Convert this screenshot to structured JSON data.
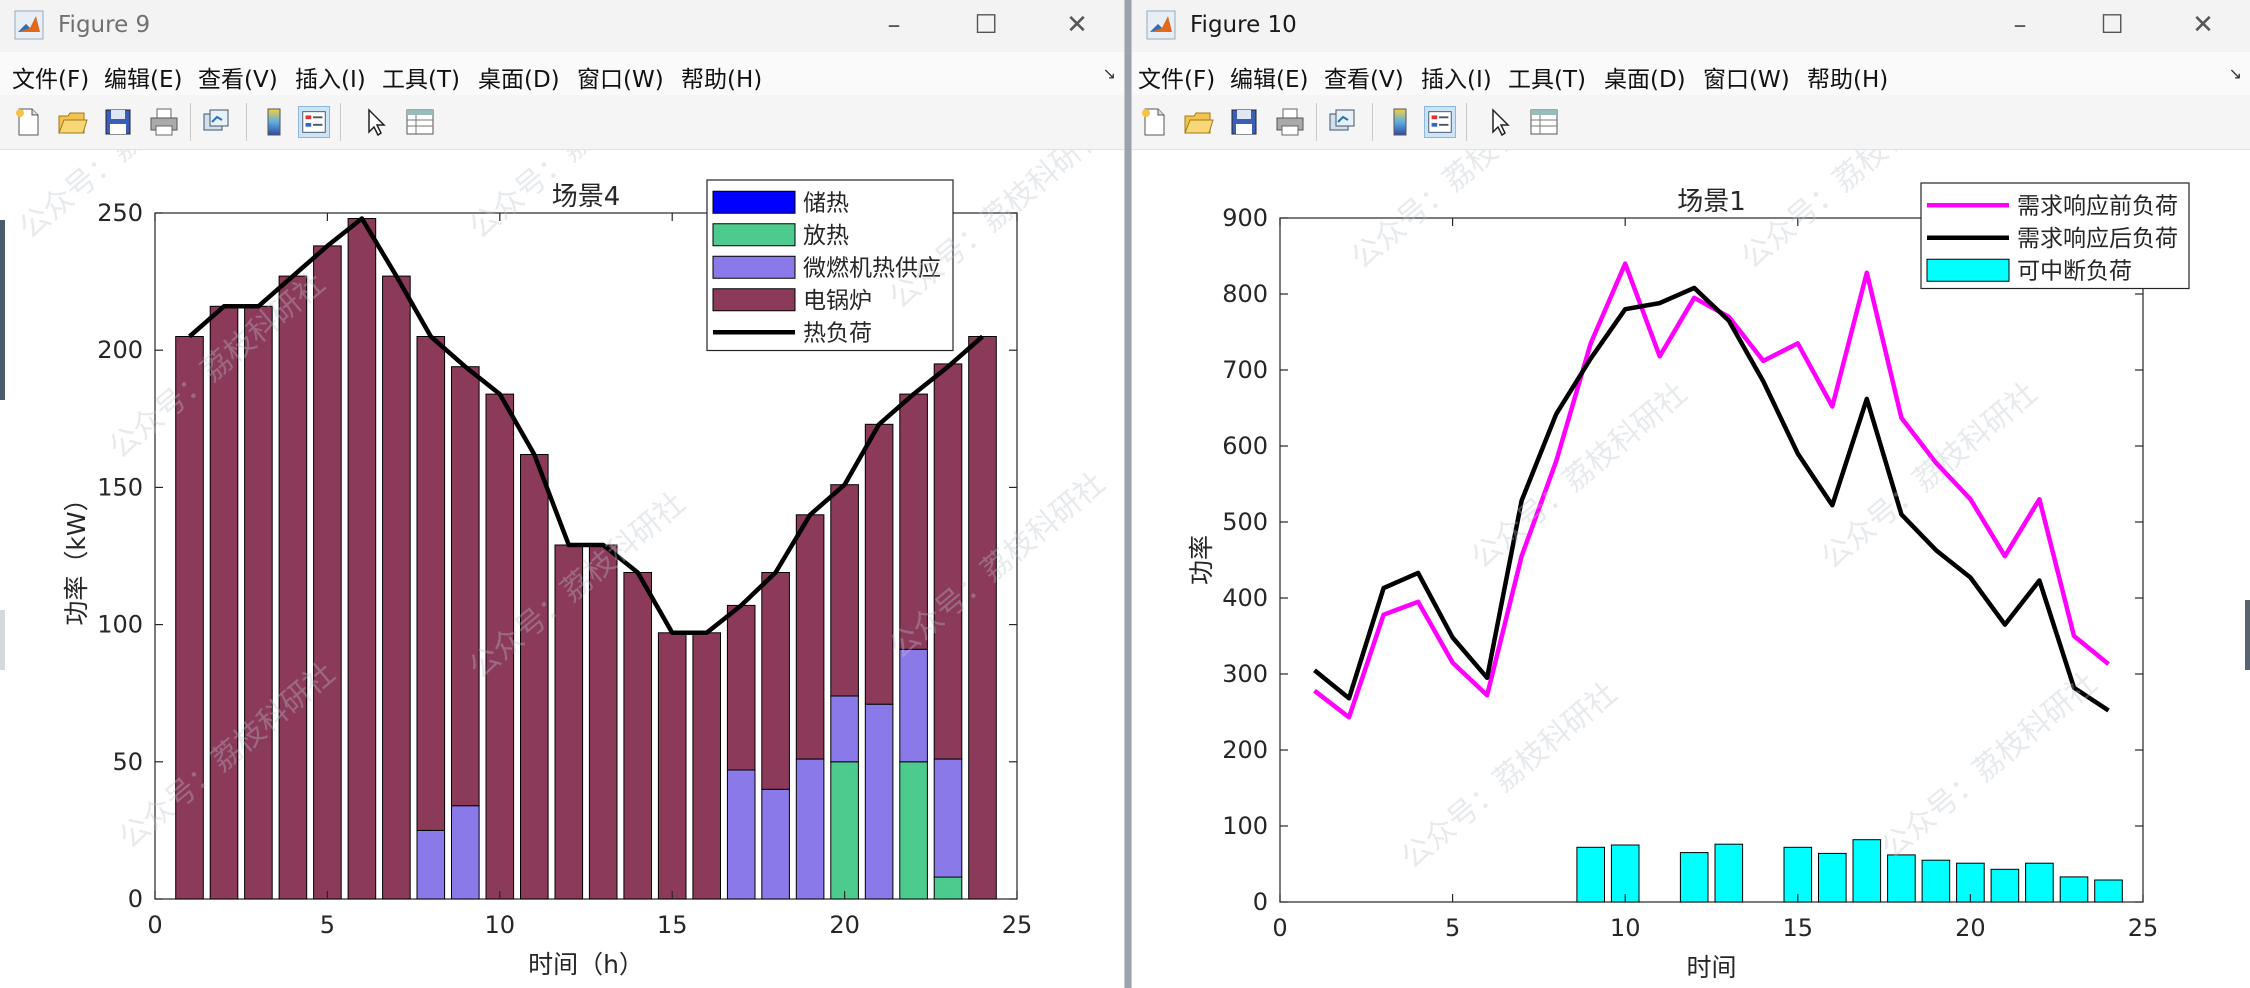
{
  "windows": [
    {
      "title": "Figure 9",
      "menus": [
        "文件(F)",
        "编辑(E)",
        "查看(V)",
        "插入(I)",
        "工具(T)",
        "桌面(D)",
        "窗口(W)",
        "帮助(H)"
      ],
      "toolbar_icons": [
        "new-figure-icon",
        "open-file-icon",
        "save-icon",
        "print-icon",
        "link-plot-icon",
        "colorbar-icon",
        "legend-icon",
        "pointer-icon",
        "property-inspector-icon"
      ]
    },
    {
      "title": "Figure 10",
      "menus": [
        "文件(F)",
        "编辑(E)",
        "查看(V)",
        "插入(I)",
        "工具(T)",
        "桌面(D)",
        "窗口(W)",
        "帮助(H)"
      ],
      "toolbar_icons": [
        "new-figure-icon",
        "open-file-icon",
        "save-icon",
        "print-icon",
        "link-plot-icon",
        "colorbar-icon",
        "legend-icon",
        "pointer-icon",
        "property-inspector-icon"
      ]
    }
  ],
  "watermark": "公众号：荔枝科研社",
  "colors": {
    "storage": "#0000ff",
    "release": "#4dcb8f",
    "turbine": "#8a79e8",
    "boiler": "#8b3a5a",
    "magenta": "#ff00ff",
    "black": "#000000",
    "cyan": "#00ffff"
  },
  "chart_data": [
    {
      "type": "bar",
      "stacked": true,
      "title": "场景4",
      "xlabel": "时间（h）",
      "ylabel": "功率（kW）",
      "xlim": [
        0,
        25
      ],
      "ylim": [
        0,
        250
      ],
      "xticks": [
        0,
        5,
        10,
        15,
        20,
        25
      ],
      "yticks": [
        0,
        50,
        100,
        150,
        200,
        250
      ],
      "legend_position": "top-right",
      "x": [
        1,
        2,
        3,
        4,
        5,
        6,
        7,
        8,
        9,
        10,
        11,
        12,
        13,
        14,
        15,
        16,
        17,
        18,
        19,
        20,
        21,
        22,
        23,
        24
      ],
      "series": [
        {
          "name": "储热",
          "kind": "bar",
          "color": "#0000ff",
          "values": [
            0,
            0,
            0,
            0,
            0,
            0,
            0,
            0,
            0,
            0,
            0,
            0,
            0,
            0,
            0,
            0,
            0,
            0,
            0,
            0,
            0,
            0,
            0,
            0
          ]
        },
        {
          "name": "放热",
          "kind": "bar",
          "color": "#4dcb8f",
          "values": [
            0,
            0,
            0,
            0,
            0,
            0,
            0,
            0,
            0,
            0,
            0,
            0,
            0,
            0,
            0,
            0,
            0,
            0,
            0,
            50,
            0,
            50,
            8,
            0
          ]
        },
        {
          "name": "微燃机热供应",
          "kind": "bar",
          "color": "#8a79e8",
          "values": [
            0,
            0,
            0,
            0,
            0,
            0,
            0,
            25,
            34,
            0,
            0,
            0,
            0,
            0,
            0,
            0,
            47,
            40,
            51,
            24,
            71,
            41,
            43,
            0
          ]
        },
        {
          "name": "电锅炉",
          "kind": "bar",
          "color": "#8b3a5a",
          "values": [
            205,
            216,
            216,
            227,
            238,
            248,
            227,
            180,
            160,
            184,
            162,
            129,
            129,
            119,
            97,
            97,
            60,
            79,
            89,
            77,
            102,
            93,
            144,
            205
          ]
        },
        {
          "name": "热负荷",
          "kind": "line",
          "color": "#000000",
          "values": [
            205,
            216,
            216,
            227,
            238,
            248,
            227,
            205,
            194,
            184,
            162,
            129,
            129,
            119,
            97,
            97,
            107,
            119,
            140,
            151,
            173,
            184,
            194,
            205
          ]
        }
      ]
    },
    {
      "type": "line",
      "title": "场景1",
      "xlabel": "时间",
      "ylabel": "功率",
      "xlim": [
        0,
        25
      ],
      "ylim": [
        0,
        900
      ],
      "xticks": [
        0,
        5,
        10,
        15,
        20,
        25
      ],
      "yticks": [
        0,
        100,
        200,
        300,
        400,
        500,
        600,
        700,
        800,
        900
      ],
      "legend_position": "top-right",
      "x": [
        1,
        2,
        3,
        4,
        5,
        6,
        7,
        8,
        9,
        10,
        11,
        12,
        13,
        14,
        15,
        16,
        17,
        18,
        19,
        20,
        21,
        22,
        23,
        24
      ],
      "series": [
        {
          "name": "需求响应前负荷",
          "kind": "line",
          "color": "#ff00ff",
          "values": [
            278,
            243,
            378,
            395,
            315,
            272,
            455,
            580,
            735,
            840,
            718,
            795,
            770,
            712,
            735,
            652,
            828,
            637,
            578,
            530,
            455,
            530,
            350,
            313
          ]
        },
        {
          "name": "需求响应后负荷",
          "kind": "line",
          "color": "#000000",
          "values": [
            305,
            268,
            413,
            433,
            348,
            295,
            528,
            642,
            715,
            780,
            788,
            808,
            765,
            685,
            590,
            522,
            662,
            510,
            463,
            427,
            365,
            423,
            282,
            252
          ]
        },
        {
          "name": "可中断负荷",
          "kind": "bar",
          "color": "#00ffff",
          "values": [
            0,
            0,
            0,
            0,
            0,
            0,
            0,
            0,
            72,
            75,
            0,
            65,
            76,
            0,
            72,
            64,
            82,
            62,
            55,
            51,
            43,
            51,
            33,
            29
          ]
        }
      ]
    }
  ]
}
